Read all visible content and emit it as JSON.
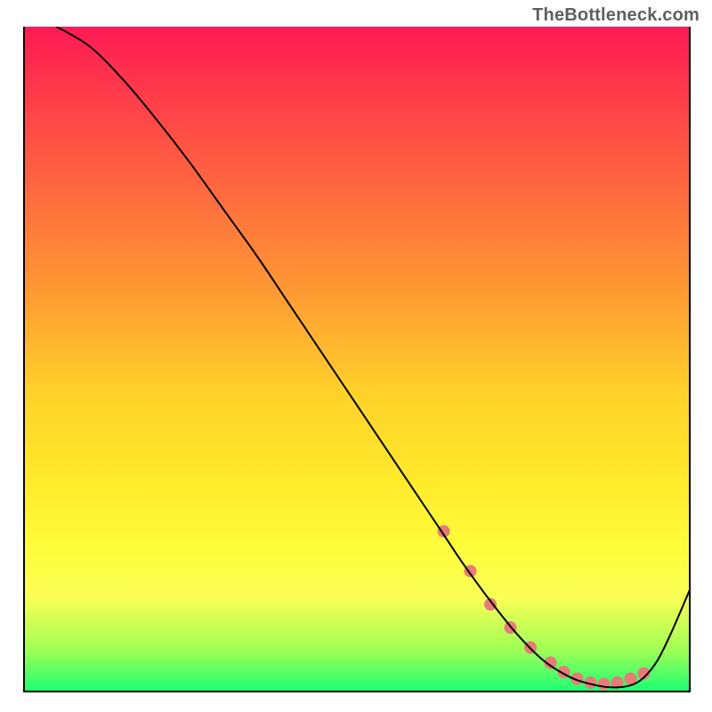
{
  "attribution": "TheBottleneck.com",
  "chart_data": {
    "type": "line",
    "title": "",
    "xlabel": "",
    "ylabel": "",
    "xlim": [
      0,
      100
    ],
    "ylim": [
      0,
      100
    ],
    "grid": false,
    "legend": false,
    "series": [
      {
        "name": "bottleneck-curve",
        "color": "#000000",
        "stroke_width": 2,
        "x": [
          5,
          10,
          15,
          20,
          25,
          30,
          35,
          40,
          45,
          50,
          55,
          60,
          63,
          66,
          70,
          74,
          78,
          82,
          85,
          88,
          91,
          93,
          95,
          97,
          100
        ],
        "values": [
          100,
          97,
          92,
          86,
          79.5,
          72.5,
          65.5,
          58,
          50.5,
          43,
          35.5,
          28,
          23.5,
          19,
          13.5,
          8.5,
          4.5,
          2,
          1,
          0.5,
          0.8,
          2,
          4.5,
          8.5,
          15.5
        ]
      },
      {
        "name": "highlight-markers",
        "type": "scatter",
        "color": "#e77b78",
        "marker_radius": 7,
        "x": [
          63,
          67,
          70,
          73,
          76,
          79,
          81,
          83,
          85,
          87,
          89,
          91,
          93
        ],
        "values": [
          24,
          18,
          13,
          9.5,
          6.5,
          4.2,
          2.8,
          1.8,
          1.2,
          1.0,
          1.2,
          1.8,
          2.6
        ]
      }
    ],
    "background_gradient": {
      "direction": "vertical",
      "stops": [
        {
          "pos": 0.0,
          "color": "#ff1a55"
        },
        {
          "pos": 0.25,
          "color": "#ff6a3f"
        },
        {
          "pos": 0.55,
          "color": "#ffd12a"
        },
        {
          "pos": 0.86,
          "color": "#f9ff55"
        },
        {
          "pos": 1.0,
          "color": "#1fff72"
        }
      ]
    }
  }
}
